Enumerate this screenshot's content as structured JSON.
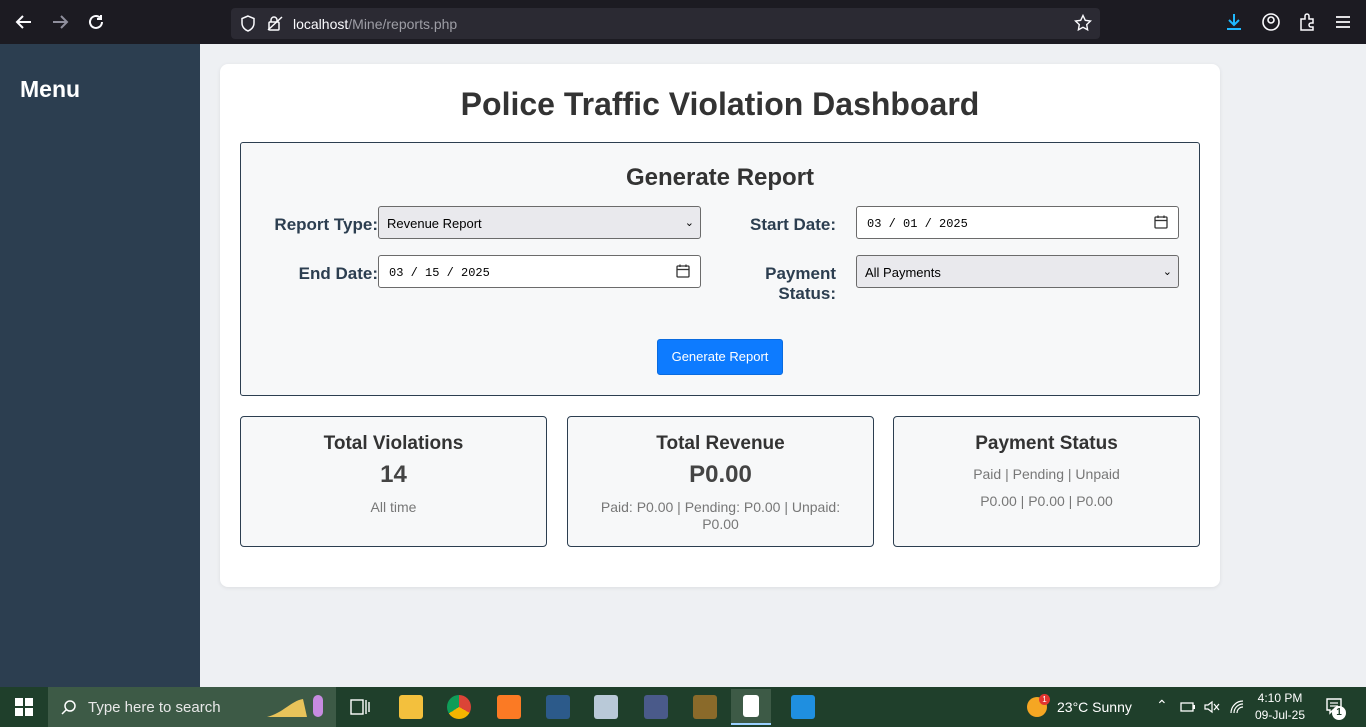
{
  "browser": {
    "url_host": "localhost",
    "url_path": "/Mine/reports.php"
  },
  "sidebar": {
    "title": "Menu"
  },
  "main": {
    "title": "Police Traffic Violation Dashboard",
    "form": {
      "title": "Generate Report",
      "report_type_label": "Report Type:",
      "report_type_value": "Revenue Report",
      "start_date_label": "Start Date:",
      "start_date_value": "03 / 01 / 2025",
      "end_date_label": "End Date:",
      "end_date_value": "03 / 15 / 2025",
      "payment_status_label": "Payment Status:",
      "payment_status_value": "All Payments",
      "submit_label": "Generate Report"
    },
    "cards": [
      {
        "title": "Total Violations",
        "value": "14",
        "sub": "All time"
      },
      {
        "title": "Total Revenue",
        "value": "P0.00",
        "sub": "Paid: P0.00 | Pending: P0.00 | Unpaid: P0.00"
      },
      {
        "title": "Payment Status",
        "line1": "Paid | Pending | Unpaid",
        "line2": "P0.00 | P0.00 | P0.00"
      }
    ]
  },
  "taskbar": {
    "search_placeholder": "Type here to search",
    "weather": "23°C  Sunny",
    "weather_badge": "1",
    "time": "4:10 PM",
    "date": "09-Jul-25",
    "notification_count": "1"
  },
  "colors": {
    "sidebar": "#2c3e50",
    "accent": "#0d7bff",
    "taskbar": "#1f3f2b"
  }
}
